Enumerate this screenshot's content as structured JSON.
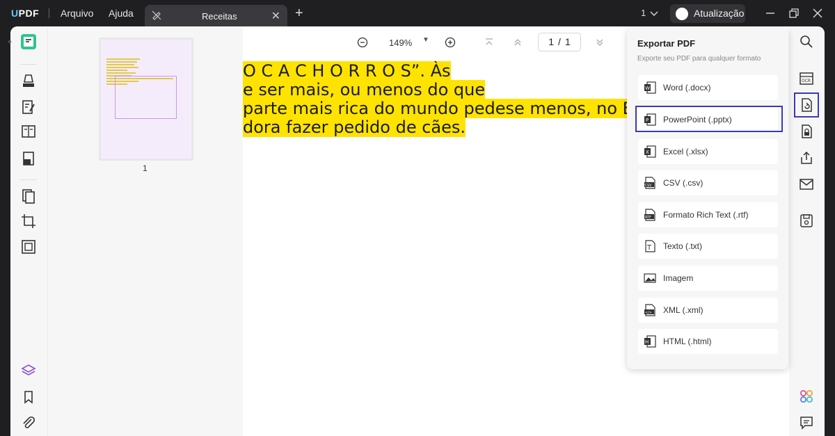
{
  "app": {
    "logo_u": "U",
    "logo_rest": "PDF"
  },
  "menu": {
    "file": "Arquivo",
    "help": "Ajuda"
  },
  "tab": {
    "label": "Receitas",
    "close": "✕",
    "add": "+"
  },
  "window": {
    "count": "1",
    "update_label": "Atualização"
  },
  "toolbar": {
    "zoom": "149%",
    "page_current": "1",
    "page_sep": "/",
    "page_total": "1"
  },
  "thumbnail": {
    "page_number": "1"
  },
  "document": {
    "lines": [
      "O C A C H O R R O S”. Às",
      "e ser mais, ou menos do que",
      " parte mais rica do mundo pedese menos, no Brasil pede",
      "dora fazer pedido de cães."
    ]
  },
  "export_panel": {
    "title": "Exportar PDF",
    "subtitle": "Exporte seu PDF para qualquer formato",
    "items": [
      {
        "label": "Word (.docx)",
        "icon": "word-icon"
      },
      {
        "label": "PowerPoint (.pptx)",
        "icon": "powerpoint-icon"
      },
      {
        "label": "Excel (.xlsx)",
        "icon": "excel-icon"
      },
      {
        "label": "CSV (.csv)",
        "icon": "csv-icon"
      },
      {
        "label": "Formato Rich Text (.rtf)",
        "icon": "rtf-icon"
      },
      {
        "label": "Texto (.txt)",
        "icon": "txt-icon"
      },
      {
        "label": "Imagem",
        "icon": "image-icon"
      },
      {
        "label": "XML (.xml)",
        "icon": "xml-icon"
      },
      {
        "label": "HTML (.html)",
        "icon": "html-icon"
      }
    ]
  },
  "colors": {
    "accent": "#3a3ab0",
    "highlight": "#ffe300",
    "brand": "#5ad0ff"
  }
}
